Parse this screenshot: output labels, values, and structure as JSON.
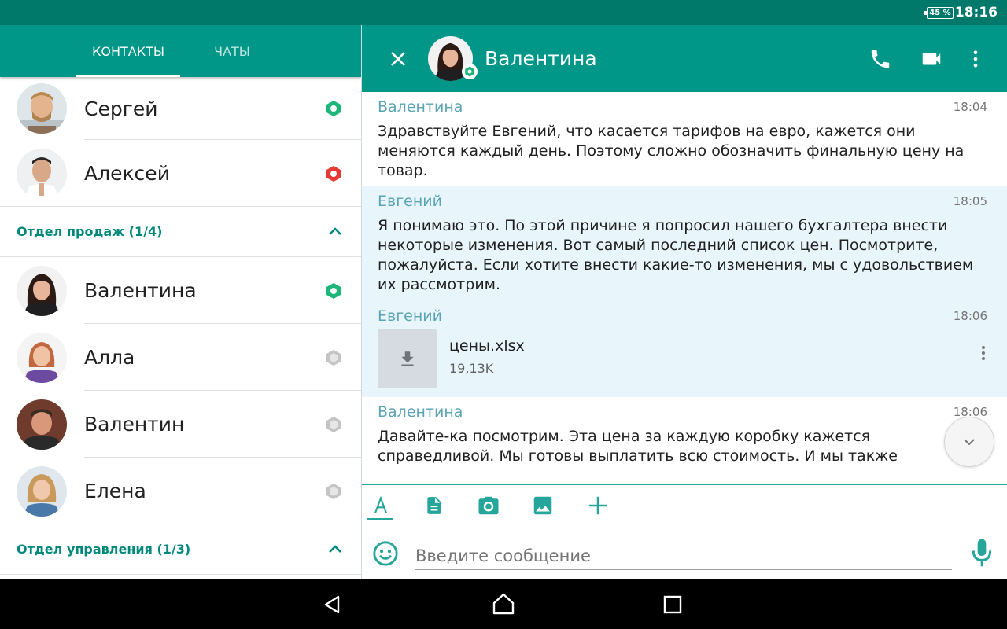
{
  "status_bar": {
    "battery": "45 %",
    "time": "18:16"
  },
  "tabs": [
    {
      "label": "КОНТАКТЫ",
      "active": true
    },
    {
      "label": "ЧАТЫ",
      "active": false
    }
  ],
  "contacts_top": [
    {
      "name": "Сергей",
      "status": "online",
      "status_color": "#1db67a",
      "avatar_color": "#c8a88a"
    },
    {
      "name": "Алексей",
      "status": "busy",
      "status_color": "#e53935",
      "avatar_color": "#7a8087"
    }
  ],
  "groups": [
    {
      "title": "Отдел продаж (1/4)",
      "expanded": true,
      "contacts": [
        {
          "name": "Валентина",
          "status": "online",
          "status_color": "#1db67a",
          "avatar_color": "#5a3a30"
        },
        {
          "name": "Алла",
          "status": "offline",
          "status_color": "#b0b0b0",
          "avatar_color": "#b5634a"
        },
        {
          "name": "Валентин",
          "status": "offline",
          "status_color": "#b0b0b0",
          "avatar_color": "#8a5a48"
        },
        {
          "name": "Елена",
          "status": "offline",
          "status_color": "#b0b0b0",
          "avatar_color": "#c9a070"
        }
      ]
    },
    {
      "title": "Отдел управления (1/3)",
      "expanded": true,
      "contacts": []
    }
  ],
  "chat": {
    "contact_name": "Валентина",
    "contact_status": "online",
    "messages": [
      {
        "sender": "Валентина",
        "time": "18:04",
        "direction": "incoming",
        "text": "Здравствуйте Евгений, что касается тарифов на евро, кажется они меняются каждый день. Поэтому сложно обозначить финальную цену на товар."
      },
      {
        "sender": "Евгений",
        "time": "18:05",
        "direction": "outgoing",
        "text": "Я понимаю это. По этой причине я попросил нашего бухгалтера внести некоторые изменения. Вот самый последний список цен. Посмотрите, пожалуйста. Если хотите внести какие-то изменения, мы с удовольствием их рассмотрим."
      },
      {
        "sender": "Евгений",
        "time": "18:06",
        "direction": "outgoing",
        "file": {
          "name": "цены.xlsx",
          "size": "19,13K"
        }
      },
      {
        "sender": "Валентина",
        "time": "18:06",
        "direction": "incoming",
        "text": "Давайте-ка посмотрим. Эта цена за каждую коробку кажется справедливой. Мы готовы выплатить всю стоимость. И мы также"
      }
    ],
    "input_placeholder": "Введите сообщение"
  },
  "colors": {
    "status_bar": "#00796b",
    "primary": "#009688",
    "accent": "#26a69a",
    "group_title": "#00897b",
    "sender": "#5aa4b3",
    "outgoing_bg": "#e8f6fb"
  },
  "icons": {
    "chat_header": [
      "close-icon",
      "phone-icon",
      "videocam-icon",
      "more-vert-icon"
    ],
    "composer_tools": [
      "text-format-icon",
      "document-icon",
      "camera-icon",
      "image-icon",
      "plus-icon"
    ],
    "composer": [
      "emoji-icon",
      "mic-icon"
    ],
    "nav": [
      "back-icon",
      "home-icon",
      "recent-apps-icon"
    ]
  }
}
